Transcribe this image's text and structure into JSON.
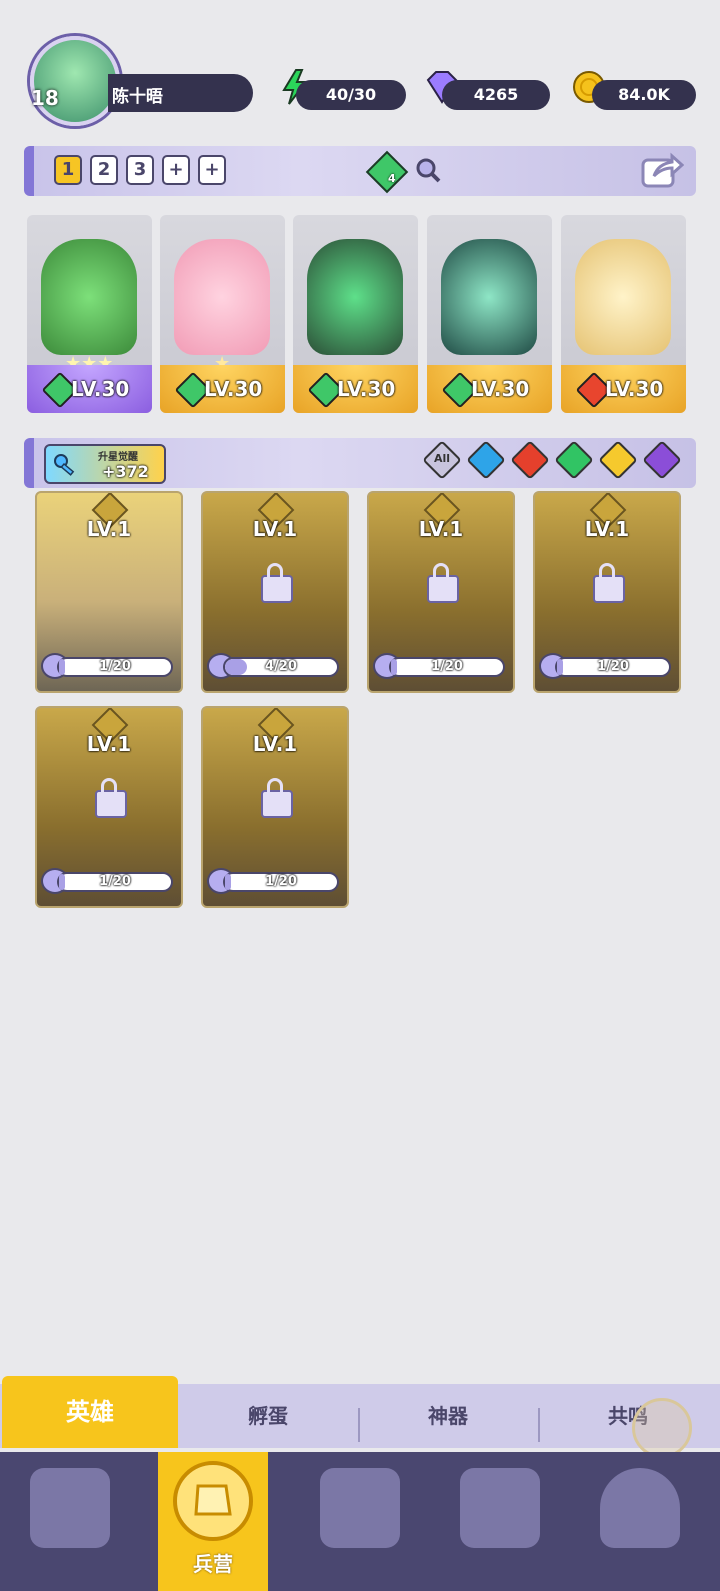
{
  "player": {
    "level": "18",
    "name": "陈十晤"
  },
  "resources": {
    "energy": "40/30",
    "gems": "4265",
    "coins": "84.0K"
  },
  "team_tabs": [
    "1",
    "2",
    "3",
    "+",
    "+"
  ],
  "team_badge": "4",
  "heroes": [
    {
      "level": "LV.30",
      "element": "leaf",
      "stars": 3
    },
    {
      "level": "LV.30",
      "element": "leaf",
      "stars": 1
    },
    {
      "level": "LV.30",
      "element": "leaf",
      "stars": 0
    },
    {
      "level": "LV.30",
      "element": "leaf",
      "stars": 0
    },
    {
      "level": "LV.30",
      "element": "fire",
      "stars": 0
    }
  ],
  "awaken": {
    "label": "升星觉醒",
    "value": "+372"
  },
  "filters": [
    "All"
  ],
  "locked_heroes": [
    {
      "level": "LV.1",
      "progress": "1/20",
      "fraction": 0.05
    },
    {
      "level": "LV.1",
      "progress": "4/20",
      "fraction": 0.2
    },
    {
      "level": "LV.1",
      "progress": "1/20",
      "fraction": 0.05
    },
    {
      "level": "LV.1",
      "progress": "1/20",
      "fraction": 0.05
    },
    {
      "level": "LV.1",
      "progress": "1/20",
      "fraction": 0.05
    },
    {
      "level": "LV.1",
      "progress": "1/20",
      "fraction": 0.05
    }
  ],
  "subtabs": {
    "heroes": "英雄",
    "hatch": "孵蛋",
    "artifacts": "神器",
    "resonance": "共鸣"
  },
  "nav": {
    "barracks": "兵营"
  }
}
